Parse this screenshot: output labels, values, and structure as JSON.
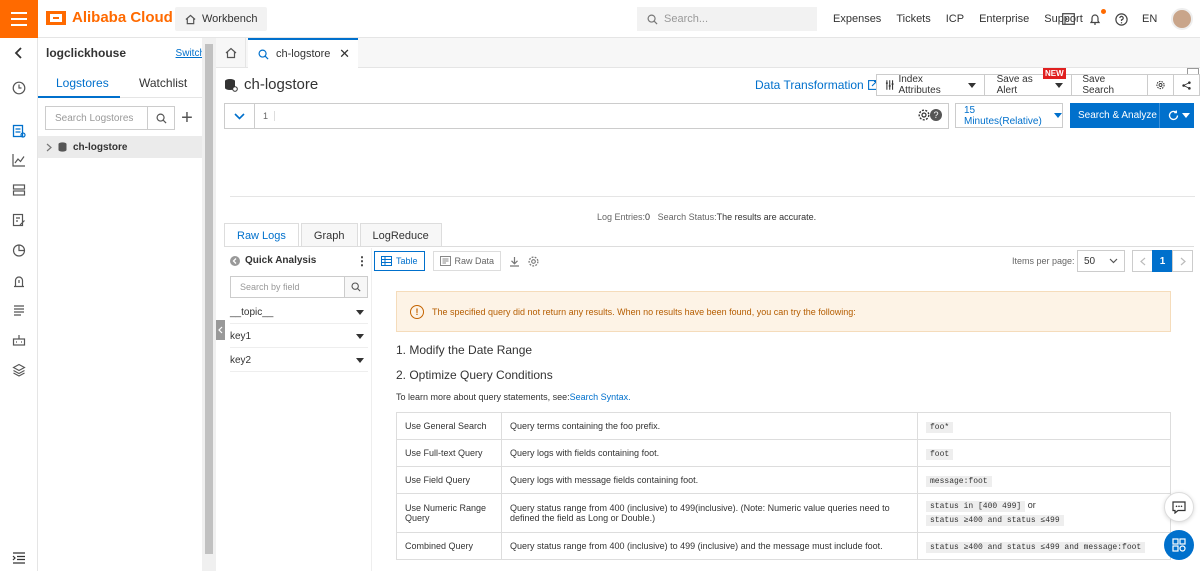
{
  "header": {
    "logo_text": "Alibaba Cloud",
    "workbench_label": "Workbench",
    "search_placeholder": "Search...",
    "nav": [
      "Expenses",
      "Tickets",
      "ICP",
      "Enterprise",
      "Support"
    ],
    "language": "EN",
    "brand_color": "#ff6a00"
  },
  "sidebar": {
    "project_name": "logclickhouse",
    "switch_label": "Switch",
    "tabs": [
      "Logstores",
      "Watchlist"
    ],
    "search_placeholder": "Search Logstores",
    "items": [
      {
        "label": "ch-logstore"
      }
    ]
  },
  "rail_icons": [
    "clock-icon",
    "logstore-icon",
    "chart-icon",
    "database-icon",
    "edit-icon",
    "pie-icon",
    "alert-icon",
    "list-icon",
    "robot-icon",
    "layers-icon",
    "expand-icon"
  ],
  "tabs": {
    "active_label": "ch-logstore"
  },
  "main": {
    "title": "ch-logstore",
    "data_transformation": "Data Transformation",
    "index_attributes": "Index Attributes",
    "save_as_alert": "Save as Alert",
    "new_badge": "NEW",
    "save_search": "Save Search",
    "query_line_number": "1",
    "time_range": "15 Minutes(Relative)",
    "search_analyze": "Search & Analyze",
    "status_entries_label": "Log Entries:",
    "status_entries_value": "0",
    "status_label": "Search Status:",
    "status_value": "The results are accurate.",
    "accent": "#0070cc"
  },
  "result_tabs": [
    "Raw Logs",
    "Graph",
    "LogReduce"
  ],
  "quick_analysis": {
    "title": "Quick Analysis",
    "search_placeholder": "Search by field",
    "fields": [
      "__topic__",
      "key1",
      "key2"
    ]
  },
  "view": {
    "table_label": "Table",
    "raw_label": "Raw Data",
    "items_per_page_label": "Items per page:",
    "items_per_page_value": "50",
    "current_page": "1"
  },
  "no_results": {
    "alert": "The specified query did not return any results. When no results have been found, you can try the following:",
    "step1": "1. Modify the Date Range",
    "step2": "2. Optimize Query Conditions",
    "learn_prefix": "To learn more about query statements, see:",
    "learn_link": "Search Syntax.",
    "rows": [
      {
        "name": "Use General Search",
        "desc": "Query terms containing the foo prefix.",
        "code1": "foo*",
        "or": "",
        "code2": ""
      },
      {
        "name": "Use Full-text Query",
        "desc": "Query logs with fields containing foot.",
        "code1": "foot",
        "or": "",
        "code2": ""
      },
      {
        "name": "Use Field Query",
        "desc": "Query logs with message fields containing foot.",
        "code1": "message:foot",
        "or": "",
        "code2": ""
      },
      {
        "name": "Use Numeric Range Query",
        "desc": "Query status range from 400 (inclusive) to 499(inclusive). (Note: Numeric value queries need to defined the field as Long or Double.)",
        "code1": "status in [400 499]",
        "or": "or",
        "code2": "status ≥400 and status ≤499"
      },
      {
        "name": "Combined Query",
        "desc": "Query status range from 400 (inclusive) to 499 (inclusive) and the message must include foot.",
        "code1": "status ≥400 and status ≤499 and message:foot",
        "or": "",
        "code2": ""
      }
    ]
  }
}
